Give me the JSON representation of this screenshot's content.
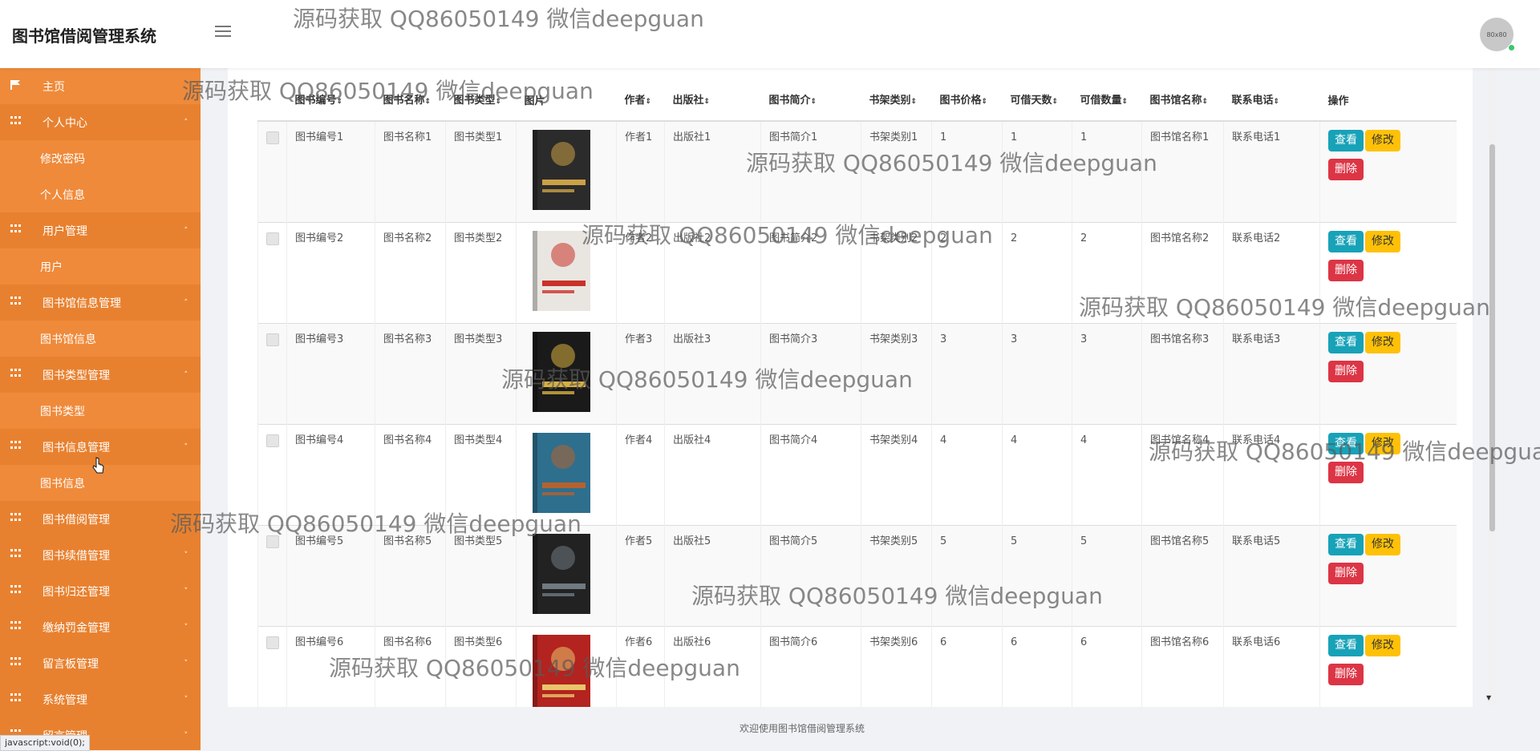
{
  "header": {
    "title": "图书馆借阅管理系统",
    "avatar_text": "80x80"
  },
  "sidebar": {
    "items": [
      {
        "label": "主页",
        "type": "top",
        "icon": "flag-icon"
      },
      {
        "label": "个人中心",
        "type": "group",
        "icon": "grid-icon",
        "caret": "˄"
      },
      {
        "label": "修改密码",
        "type": "sub"
      },
      {
        "label": "个人信息",
        "type": "sub"
      },
      {
        "label": "用户管理",
        "type": "group",
        "icon": "grid-icon",
        "caret": "˄"
      },
      {
        "label": "用户",
        "type": "sub"
      },
      {
        "label": "图书馆信息管理",
        "type": "group",
        "icon": "grid-icon",
        "caret": "˄"
      },
      {
        "label": "图书馆信息",
        "type": "sub"
      },
      {
        "label": "图书类型管理",
        "type": "group",
        "icon": "grid-icon",
        "caret": "˄"
      },
      {
        "label": "图书类型",
        "type": "sub"
      },
      {
        "label": "图书信息管理",
        "type": "group",
        "icon": "grid-icon",
        "caret": "˄"
      },
      {
        "label": "图书信息",
        "type": "sub"
      },
      {
        "label": "图书借阅管理",
        "type": "group",
        "icon": "grid-icon",
        "caret": ""
      },
      {
        "label": "图书续借管理",
        "type": "group",
        "icon": "grid-icon",
        "caret": "˅"
      },
      {
        "label": "图书归还管理",
        "type": "group",
        "icon": "grid-icon",
        "caret": "˅"
      },
      {
        "label": "缴纳罚金管理",
        "type": "group",
        "icon": "grid-icon",
        "caret": "˅"
      },
      {
        "label": "留言板管理",
        "type": "group",
        "icon": "grid-icon",
        "caret": "˅"
      },
      {
        "label": "系统管理",
        "type": "group",
        "icon": "grid-icon",
        "caret": "˅"
      },
      {
        "label": "留言管理",
        "type": "group",
        "icon": "grid-icon",
        "caret": "˅"
      }
    ]
  },
  "table": {
    "columns": [
      "图书编号",
      "图书名称",
      "图书类型",
      "图片",
      "作者",
      "出版社",
      "图书简介",
      "书架类别",
      "图书价格",
      "可借天数",
      "可借数量",
      "图书馆名称",
      "联系电话",
      "操作"
    ],
    "sort_icon": "⇕",
    "rows": [
      {
        "id": "图书编号1",
        "name": "图书名称1",
        "type": "图书类型1",
        "author": "作者1",
        "publisher": "出版社1",
        "intro": "图书简介1",
        "shelf": "书架类别1",
        "price": "1",
        "days": "1",
        "qty": "1",
        "library": "图书馆名称1",
        "phone": "联系电话1",
        "cover_color": "#2b2b2b",
        "cover_accent": "#caa146"
      },
      {
        "id": "图书编号2",
        "name": "图书名称2",
        "type": "图书类型2",
        "author": "作者2",
        "publisher": "出版社2",
        "intro": "图书简介2",
        "shelf": "书架类别2",
        "price": "2",
        "days": "2",
        "qty": "2",
        "library": "图书馆名称2",
        "phone": "联系电话2",
        "cover_color": "#e9e6e1",
        "cover_accent": "#c9322a"
      },
      {
        "id": "图书编号3",
        "name": "图书名称3",
        "type": "图书类型3",
        "author": "作者3",
        "publisher": "出版社3",
        "intro": "图书简介3",
        "shelf": "书架类别3",
        "price": "3",
        "days": "3",
        "qty": "3",
        "library": "图书馆名称3",
        "phone": "联系电话3",
        "cover_color": "#1a1a1a",
        "cover_accent": "#d8b040"
      },
      {
        "id": "图书编号4",
        "name": "图书名称4",
        "type": "图书类型4",
        "author": "作者4",
        "publisher": "出版社4",
        "intro": "图书简介4",
        "shelf": "书架类别4",
        "price": "4",
        "days": "4",
        "qty": "4",
        "library": "图书馆名称4",
        "phone": "联系电话4",
        "cover_color": "#2e6f8e",
        "cover_accent": "#b5622e"
      },
      {
        "id": "图书编号5",
        "name": "图书名称5",
        "type": "图书类型5",
        "author": "作者5",
        "publisher": "出版社5",
        "intro": "图书简介5",
        "shelf": "书架类别5",
        "price": "5",
        "days": "5",
        "qty": "5",
        "library": "图书馆名称5",
        "phone": "联系电话5",
        "cover_color": "#222222",
        "cover_accent": "#6f7a82"
      },
      {
        "id": "图书编号6",
        "name": "图书名称6",
        "type": "图书类型6",
        "author": "作者6",
        "publisher": "出版社6",
        "intro": "图书简介6",
        "shelf": "书架类别6",
        "price": "6",
        "days": "6",
        "qty": "6",
        "library": "图书馆名称6",
        "phone": "联系电话6",
        "cover_color": "#b3231f",
        "cover_accent": "#e9c56a"
      }
    ],
    "actions": {
      "view": "查看",
      "edit": "修改",
      "delete": "删除"
    }
  },
  "footer": {
    "text": "欢迎使用图书馆借阅管理系统"
  },
  "watermark": "源码获取 QQ86050149 微信deepguan",
  "status_bar": "javascript:void(0);",
  "colors": {
    "sidebar": "#ef8a3a",
    "view": "#17a2b8",
    "edit": "#ffc107",
    "delete": "#dc3545"
  }
}
